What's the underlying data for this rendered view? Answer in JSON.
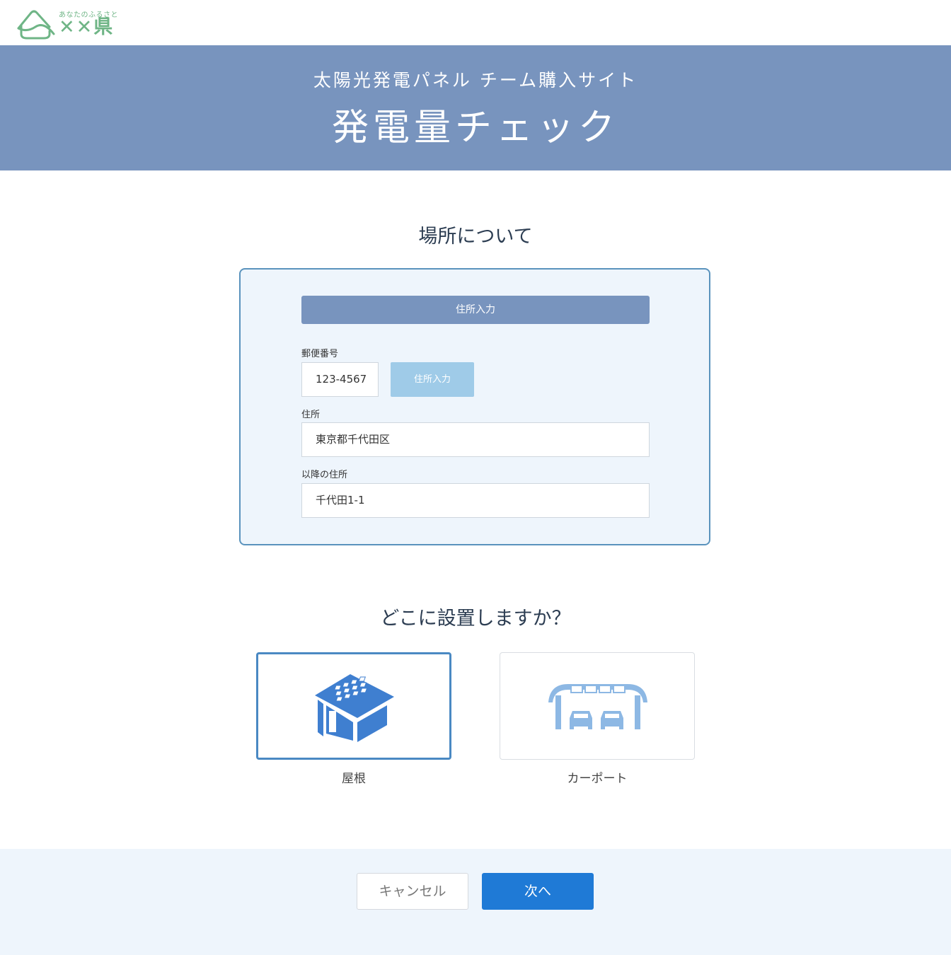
{
  "logo": {
    "tagline": "あなたのふるさと",
    "name": "✕✕県"
  },
  "hero": {
    "subtitle": "太陽光発電パネル チーム購入サイト",
    "title": "発電量チェック"
  },
  "location": {
    "title": "場所について",
    "header_label": "住所入力",
    "postal_label": "郵便番号",
    "postal_value": "123-4567",
    "postal_button": "住所入力",
    "address_label": "住所",
    "address_value": "東京都千代田区",
    "address2_label": "以降の住所",
    "address2_value": "千代田1-1"
  },
  "install": {
    "title": "どこに設置しますか？",
    "options": [
      {
        "label": "屋根",
        "icon": "house-roof-solar-icon",
        "selected": true
      },
      {
        "label": "カーポート",
        "icon": "carport-solar-icon",
        "selected": false
      }
    ]
  },
  "footer": {
    "cancel": "キャンセル",
    "next": "次へ"
  },
  "colors": {
    "hero": "#7894be",
    "accent": "#1f7ad6",
    "logo": "#6fb586",
    "panel_bg": "#eef5fc"
  }
}
